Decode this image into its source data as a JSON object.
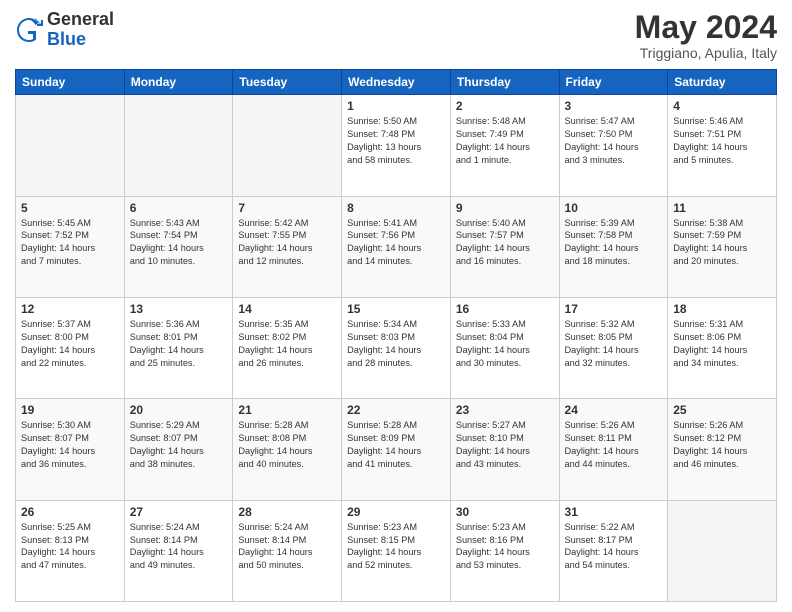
{
  "header": {
    "logo": {
      "general": "General",
      "blue": "Blue"
    },
    "title": "May 2024",
    "location": "Triggiano, Apulia, Italy"
  },
  "days_of_week": [
    "Sunday",
    "Monday",
    "Tuesday",
    "Wednesday",
    "Thursday",
    "Friday",
    "Saturday"
  ],
  "weeks": [
    {
      "days": [
        {
          "num": "",
          "sunrise": "",
          "sunset": "",
          "daylight": ""
        },
        {
          "num": "",
          "sunrise": "",
          "sunset": "",
          "daylight": ""
        },
        {
          "num": "",
          "sunrise": "",
          "sunset": "",
          "daylight": ""
        },
        {
          "num": "1",
          "sunrise": "Sunrise: 5:50 AM",
          "sunset": "Sunset: 7:48 PM",
          "daylight": "Daylight: 13 hours and 58 minutes."
        },
        {
          "num": "2",
          "sunrise": "Sunrise: 5:48 AM",
          "sunset": "Sunset: 7:49 PM",
          "daylight": "Daylight: 14 hours and 1 minute."
        },
        {
          "num": "3",
          "sunrise": "Sunrise: 5:47 AM",
          "sunset": "Sunset: 7:50 PM",
          "daylight": "Daylight: 14 hours and 3 minutes."
        },
        {
          "num": "4",
          "sunrise": "Sunrise: 5:46 AM",
          "sunset": "Sunset: 7:51 PM",
          "daylight": "Daylight: 14 hours and 5 minutes."
        }
      ]
    },
    {
      "days": [
        {
          "num": "5",
          "sunrise": "Sunrise: 5:45 AM",
          "sunset": "Sunset: 7:52 PM",
          "daylight": "Daylight: 14 hours and 7 minutes."
        },
        {
          "num": "6",
          "sunrise": "Sunrise: 5:43 AM",
          "sunset": "Sunset: 7:54 PM",
          "daylight": "Daylight: 14 hours and 10 minutes."
        },
        {
          "num": "7",
          "sunrise": "Sunrise: 5:42 AM",
          "sunset": "Sunset: 7:55 PM",
          "daylight": "Daylight: 14 hours and 12 minutes."
        },
        {
          "num": "8",
          "sunrise": "Sunrise: 5:41 AM",
          "sunset": "Sunset: 7:56 PM",
          "daylight": "Daylight: 14 hours and 14 minutes."
        },
        {
          "num": "9",
          "sunrise": "Sunrise: 5:40 AM",
          "sunset": "Sunset: 7:57 PM",
          "daylight": "Daylight: 14 hours and 16 minutes."
        },
        {
          "num": "10",
          "sunrise": "Sunrise: 5:39 AM",
          "sunset": "Sunset: 7:58 PM",
          "daylight": "Daylight: 14 hours and 18 minutes."
        },
        {
          "num": "11",
          "sunrise": "Sunrise: 5:38 AM",
          "sunset": "Sunset: 7:59 PM",
          "daylight": "Daylight: 14 hours and 20 minutes."
        }
      ]
    },
    {
      "days": [
        {
          "num": "12",
          "sunrise": "Sunrise: 5:37 AM",
          "sunset": "Sunset: 8:00 PM",
          "daylight": "Daylight: 14 hours and 22 minutes."
        },
        {
          "num": "13",
          "sunrise": "Sunrise: 5:36 AM",
          "sunset": "Sunset: 8:01 PM",
          "daylight": "Daylight: 14 hours and 25 minutes."
        },
        {
          "num": "14",
          "sunrise": "Sunrise: 5:35 AM",
          "sunset": "Sunset: 8:02 PM",
          "daylight": "Daylight: 14 hours and 26 minutes."
        },
        {
          "num": "15",
          "sunrise": "Sunrise: 5:34 AM",
          "sunset": "Sunset: 8:03 PM",
          "daylight": "Daylight: 14 hours and 28 minutes."
        },
        {
          "num": "16",
          "sunrise": "Sunrise: 5:33 AM",
          "sunset": "Sunset: 8:04 PM",
          "daylight": "Daylight: 14 hours and 30 minutes."
        },
        {
          "num": "17",
          "sunrise": "Sunrise: 5:32 AM",
          "sunset": "Sunset: 8:05 PM",
          "daylight": "Daylight: 14 hours and 32 minutes."
        },
        {
          "num": "18",
          "sunrise": "Sunrise: 5:31 AM",
          "sunset": "Sunset: 8:06 PM",
          "daylight": "Daylight: 14 hours and 34 minutes."
        }
      ]
    },
    {
      "days": [
        {
          "num": "19",
          "sunrise": "Sunrise: 5:30 AM",
          "sunset": "Sunset: 8:07 PM",
          "daylight": "Daylight: 14 hours and 36 minutes."
        },
        {
          "num": "20",
          "sunrise": "Sunrise: 5:29 AM",
          "sunset": "Sunset: 8:07 PM",
          "daylight": "Daylight: 14 hours and 38 minutes."
        },
        {
          "num": "21",
          "sunrise": "Sunrise: 5:28 AM",
          "sunset": "Sunset: 8:08 PM",
          "daylight": "Daylight: 14 hours and 40 minutes."
        },
        {
          "num": "22",
          "sunrise": "Sunrise: 5:28 AM",
          "sunset": "Sunset: 8:09 PM",
          "daylight": "Daylight: 14 hours and 41 minutes."
        },
        {
          "num": "23",
          "sunrise": "Sunrise: 5:27 AM",
          "sunset": "Sunset: 8:10 PM",
          "daylight": "Daylight: 14 hours and 43 minutes."
        },
        {
          "num": "24",
          "sunrise": "Sunrise: 5:26 AM",
          "sunset": "Sunset: 8:11 PM",
          "daylight": "Daylight: 14 hours and 44 minutes."
        },
        {
          "num": "25",
          "sunrise": "Sunrise: 5:26 AM",
          "sunset": "Sunset: 8:12 PM",
          "daylight": "Daylight: 14 hours and 46 minutes."
        }
      ]
    },
    {
      "days": [
        {
          "num": "26",
          "sunrise": "Sunrise: 5:25 AM",
          "sunset": "Sunset: 8:13 PM",
          "daylight": "Daylight: 14 hours and 47 minutes."
        },
        {
          "num": "27",
          "sunrise": "Sunrise: 5:24 AM",
          "sunset": "Sunset: 8:14 PM",
          "daylight": "Daylight: 14 hours and 49 minutes."
        },
        {
          "num": "28",
          "sunrise": "Sunrise: 5:24 AM",
          "sunset": "Sunset: 8:14 PM",
          "daylight": "Daylight: 14 hours and 50 minutes."
        },
        {
          "num": "29",
          "sunrise": "Sunrise: 5:23 AM",
          "sunset": "Sunset: 8:15 PM",
          "daylight": "Daylight: 14 hours and 52 minutes."
        },
        {
          "num": "30",
          "sunrise": "Sunrise: 5:23 AM",
          "sunset": "Sunset: 8:16 PM",
          "daylight": "Daylight: 14 hours and 53 minutes."
        },
        {
          "num": "31",
          "sunrise": "Sunrise: 5:22 AM",
          "sunset": "Sunset: 8:17 PM",
          "daylight": "Daylight: 14 hours and 54 minutes."
        },
        {
          "num": "",
          "sunrise": "",
          "sunset": "",
          "daylight": ""
        }
      ]
    }
  ]
}
